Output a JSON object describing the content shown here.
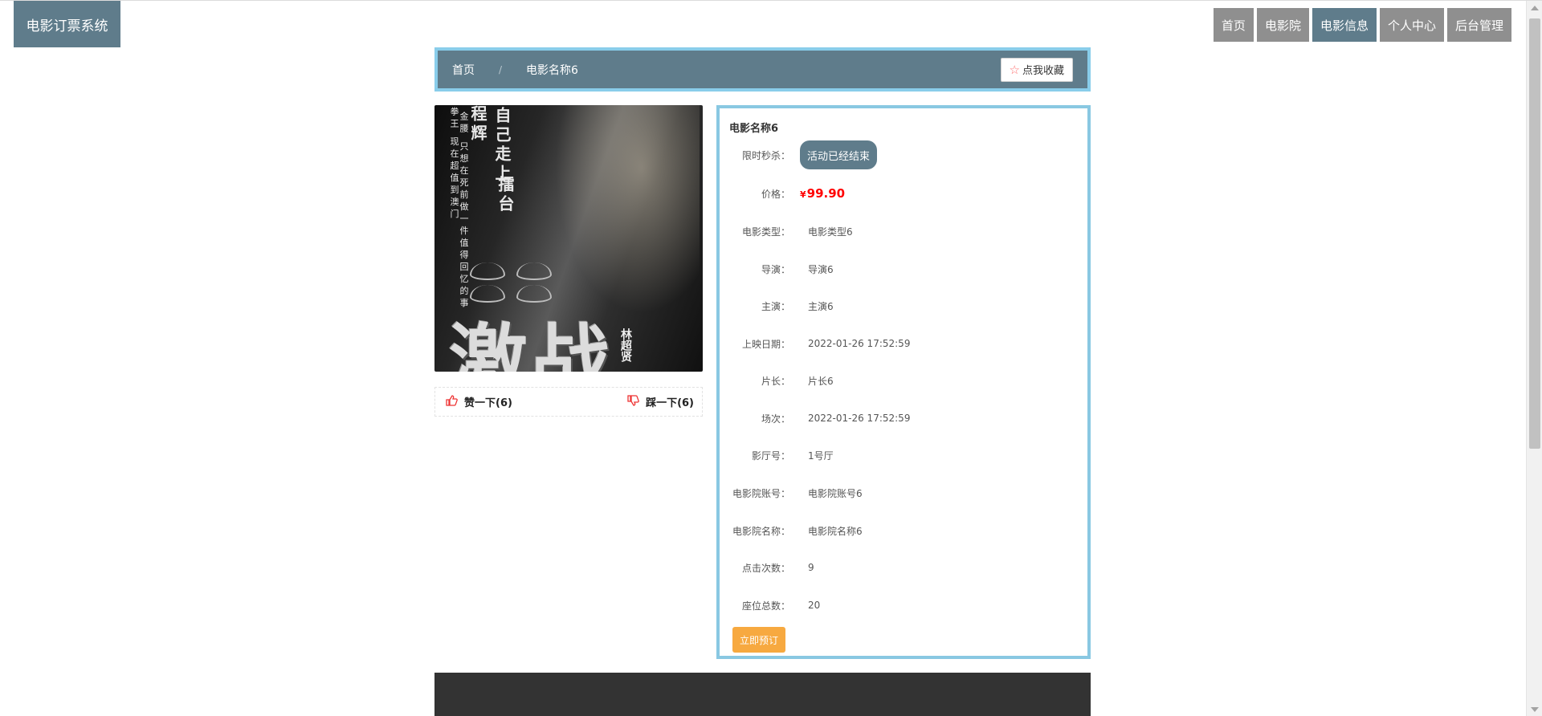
{
  "header": {
    "logo_text": "电影订票系统",
    "nav": [
      {
        "label": "首页",
        "active": false
      },
      {
        "label": "电影院",
        "active": false
      },
      {
        "label": "电影信息",
        "active": true
      },
      {
        "label": "个人中心",
        "active": false
      },
      {
        "label": "后台管理",
        "active": false
      }
    ]
  },
  "breadcrumb": {
    "home": "首页",
    "separator": "/",
    "current": "电影名称6",
    "favorite_label": "点我收藏"
  },
  "poster": {
    "title": "激战",
    "lines": [
      "自己走上",
      "擂台"
    ],
    "name_left": "程辉",
    "small_col_1": "拳王 现在超值到澳门",
    "small_col_2": "金腰 只想在死前做一件值得回忆的事",
    "director": "林超贤"
  },
  "votes": {
    "like_label": "赞一下(6)",
    "dislike_label": "踩一下(6)"
  },
  "detail": {
    "title": "电影名称6",
    "flash_sale": {
      "label": "限时秒杀：",
      "value": "活动已经结束"
    },
    "price": {
      "label": "价格：",
      "currency": "¥",
      "value": "99.90"
    },
    "rows": [
      {
        "label": "电影类型：",
        "value": "电影类型6"
      },
      {
        "label": "导演：",
        "value": "导演6"
      },
      {
        "label": "主演：",
        "value": "主演6"
      },
      {
        "label": "上映日期：",
        "value": "2022-01-26 17:52:59"
      },
      {
        "label": "片长：",
        "value": "片长6"
      },
      {
        "label": "场次：",
        "value": "2022-01-26 17:52:59"
      },
      {
        "label": "影厅号：",
        "value": "1号厅"
      },
      {
        "label": "电影院账号：",
        "value": "电影院账号6"
      },
      {
        "label": "电影院名称：",
        "value": "电影院名称6"
      },
      {
        "label": "点击次数：",
        "value": "9"
      },
      {
        "label": "座位总数：",
        "value": "20"
      }
    ],
    "book_label": "立即预订"
  },
  "colors": {
    "primary": "#5f7c8b",
    "nav_inactive": "#8f8f8f",
    "border_accent": "#89cdea",
    "price": "#ff0000",
    "book_button": "#f7a940",
    "footer": "#333333"
  }
}
